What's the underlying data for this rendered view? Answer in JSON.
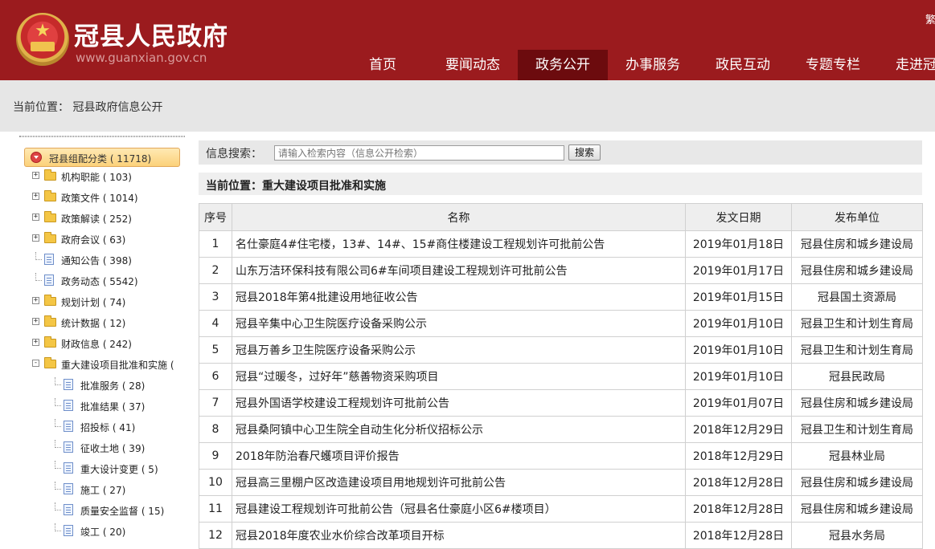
{
  "header": {
    "site_title": "冠县人民政府",
    "site_domain": "www.guanxian.gov.cn",
    "lang_switch": "繁",
    "nav": [
      {
        "label": "首页",
        "active": false
      },
      {
        "label": "要闻动态",
        "active": false
      },
      {
        "label": "政务公开",
        "active": true
      },
      {
        "label": "办事服务",
        "active": false
      },
      {
        "label": "政民互动",
        "active": false
      },
      {
        "label": "专题专栏",
        "active": false
      },
      {
        "label": "走进冠县",
        "active": false
      }
    ]
  },
  "breadcrumb": "当前位置： 冠县政府信息公开",
  "sidebar": {
    "root": "冠县组配分类 ( 11718)",
    "items": [
      {
        "label": "机构职能 ( 103)",
        "type": "folder",
        "expander": "+",
        "level": 1
      },
      {
        "label": "政策文件 ( 1014)",
        "type": "folder",
        "expander": "+",
        "level": 1
      },
      {
        "label": "政策解读 ( 252)",
        "type": "folder",
        "expander": "+",
        "level": 1
      },
      {
        "label": "政府会议 ( 63)",
        "type": "folder",
        "expander": "+",
        "level": 1
      },
      {
        "label": "通知公告 ( 398)",
        "type": "doc",
        "expander": "",
        "level": 1
      },
      {
        "label": "政务动态 ( 5542)",
        "type": "doc",
        "expander": "",
        "level": 1
      },
      {
        "label": "规划计划 ( 74)",
        "type": "folder",
        "expander": "+",
        "level": 1
      },
      {
        "label": "统计数据 ( 12)",
        "type": "folder",
        "expander": "+",
        "level": 1
      },
      {
        "label": "财政信息 ( 242)",
        "type": "folder",
        "expander": "+",
        "level": 1
      },
      {
        "label": "重大建设项目批准和实施 (",
        "type": "folder",
        "expander": "-",
        "level": 1
      },
      {
        "label": "批准服务 ( 28)",
        "type": "doc",
        "expander": "",
        "level": 2
      },
      {
        "label": "批准结果 ( 37)",
        "type": "doc",
        "expander": "",
        "level": 2
      },
      {
        "label": "招投标 ( 41)",
        "type": "doc",
        "expander": "",
        "level": 2
      },
      {
        "label": "征收土地 ( 39)",
        "type": "doc",
        "expander": "",
        "level": 2
      },
      {
        "label": "重大设计变更 ( 5)",
        "type": "doc",
        "expander": "",
        "level": 2
      },
      {
        "label": "施工 ( 27)",
        "type": "doc",
        "expander": "",
        "level": 2
      },
      {
        "label": "质量安全监督 ( 15)",
        "type": "doc",
        "expander": "",
        "level": 2
      },
      {
        "label": "竣工 ( 20)",
        "type": "doc",
        "expander": "",
        "level": 2
      }
    ]
  },
  "search": {
    "label": "信息搜索：",
    "placeholder": "请输入检索内容（信息公开检索）",
    "button": "搜索"
  },
  "location": "当前位置：重大建设项目批准和实施",
  "table": {
    "headers": [
      "序号",
      "名称",
      "发文日期",
      "发布单位"
    ],
    "rows": [
      [
        "1",
        "名仕豪庭4#住宅楼，13#、14#、15#商住楼建设工程规划许可批前公告",
        "2019年01月18日",
        "冠县住房和城乡建设局"
      ],
      [
        "2",
        "山东万洁环保科技有限公司6#车间项目建设工程规划许可批前公告",
        "2019年01月17日",
        "冠县住房和城乡建设局"
      ],
      [
        "3",
        "冠县2018年第4批建设用地征收公告",
        "2019年01月15日",
        "冠县国土资源局"
      ],
      [
        "4",
        "冠县辛集中心卫生院医疗设备采购公示",
        "2019年01月10日",
        "冠县卫生和计划生育局"
      ],
      [
        "5",
        "冠县万善乡卫生院医疗设备采购公示",
        "2019年01月10日",
        "冠县卫生和计划生育局"
      ],
      [
        "6",
        "冠县“过暖冬，过好年”慈善物资采购项目",
        "2019年01月10日",
        "冠县民政局"
      ],
      [
        "7",
        "冠县外国语学校建设工程规划许可批前公告",
        "2019年01月07日",
        "冠县住房和城乡建设局"
      ],
      [
        "8",
        "冠县桑阿镇中心卫生院全自动生化分析仪招标公示",
        "2018年12月29日",
        "冠县卫生和计划生育局"
      ],
      [
        "9",
        "2018年防治春尺蠖项目评价报告",
        "2018年12月29日",
        "冠县林业局"
      ],
      [
        "10",
        "冠县高三里棚户区改造建设项目用地规划许可批前公告",
        "2018年12月28日",
        "冠县住房和城乡建设局"
      ],
      [
        "11",
        "冠县建设工程规划许可批前公告（冠县名仕豪庭小区6#楼项目）",
        "2018年12月28日",
        "冠县住房和城乡建设局"
      ],
      [
        "12",
        "冠县2018年度农业水价综合改革项目开标",
        "2018年12月28日",
        "冠县水务局"
      ]
    ]
  }
}
